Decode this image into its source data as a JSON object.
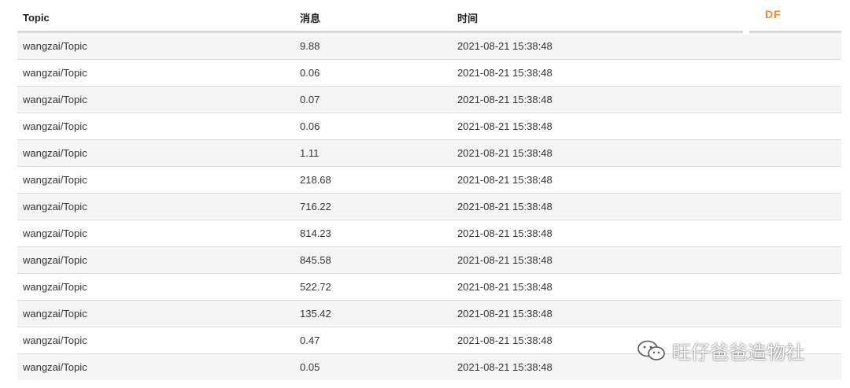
{
  "table": {
    "headers": {
      "topic": "Topic",
      "message": "消息",
      "time": "时间"
    },
    "rows": [
      {
        "topic": "wangzai/Topic",
        "message": "9.88",
        "time": "2021-08-21 15:38:48"
      },
      {
        "topic": "wangzai/Topic",
        "message": "0.06",
        "time": "2021-08-21 15:38:48"
      },
      {
        "topic": "wangzai/Topic",
        "message": "0.07",
        "time": "2021-08-21 15:38:48"
      },
      {
        "topic": "wangzai/Topic",
        "message": "0.06",
        "time": "2021-08-21 15:38:48"
      },
      {
        "topic": "wangzai/Topic",
        "message": "1.11",
        "time": "2021-08-21 15:38:48"
      },
      {
        "topic": "wangzai/Topic",
        "message": "218.68",
        "time": "2021-08-21 15:38:48"
      },
      {
        "topic": "wangzai/Topic",
        "message": "716.22",
        "time": "2021-08-21 15:38:48"
      },
      {
        "topic": "wangzai/Topic",
        "message": "814.23",
        "time": "2021-08-21 15:38:48"
      },
      {
        "topic": "wangzai/Topic",
        "message": "845.58",
        "time": "2021-08-21 15:38:48"
      },
      {
        "topic": "wangzai/Topic",
        "message": "522.72",
        "time": "2021-08-21 15:38:48"
      },
      {
        "topic": "wangzai/Topic",
        "message": "135.42",
        "time": "2021-08-21 15:38:48"
      },
      {
        "topic": "wangzai/Topic",
        "message": "0.47",
        "time": "2021-08-21 15:38:48"
      },
      {
        "topic": "wangzai/Topic",
        "message": "0.05",
        "time": "2021-08-21 15:38:48"
      }
    ]
  },
  "brand_mark": "DF",
  "watermark": {
    "icon": "wechat-icon",
    "text": "旺仔爸爸造物社"
  },
  "colors": {
    "brand": "#f08a2c",
    "row_alt": "#f5f5f5",
    "border": "#dcdcdc"
  }
}
